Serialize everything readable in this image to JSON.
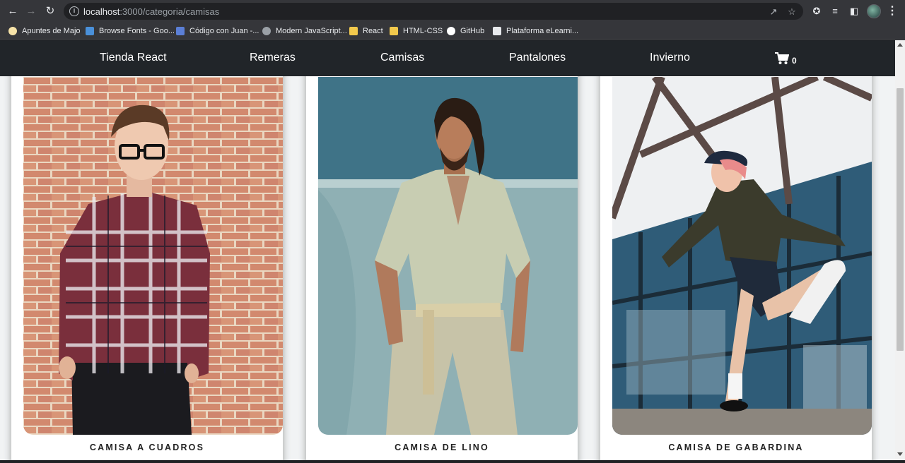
{
  "browser": {
    "url_host": "localhost",
    "url_rest": ":3000/categoria/camisas",
    "bookmarks": [
      {
        "label": "Apuntes de Majo",
        "color": "#f6e3a8"
      },
      {
        "label": "Browse Fonts - Goo...",
        "color": "#4a90d9"
      },
      {
        "label": "Código con Juan -...",
        "color": "#5b7fd6"
      },
      {
        "label": "Modern JavaScript...",
        "color": "#9aa0a6"
      },
      {
        "label": "React",
        "color": "#f2c94c"
      },
      {
        "label": "HTML-CSS",
        "color": "#f2c94c"
      },
      {
        "label": "GitHub",
        "color": "#ffffff"
      },
      {
        "label": "Plataforma eLearni...",
        "color": "#e8eaed"
      }
    ]
  },
  "navbar": {
    "brand": "Tienda React",
    "links": [
      "Remeras",
      "Camisas",
      "Pantalones",
      "Invierno"
    ],
    "cart_count": "0"
  },
  "products": [
    {
      "name": "CAMISA A CUADROS"
    },
    {
      "name": "CAMISA DE LINO"
    },
    {
      "name": "CAMISA DE GABARDINA"
    }
  ]
}
